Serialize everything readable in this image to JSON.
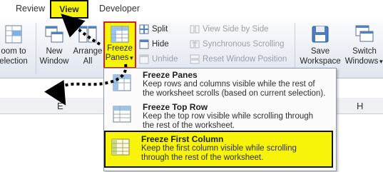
{
  "tabs": {
    "review": "Review",
    "view": "View",
    "developer": "Developer"
  },
  "ribbon": {
    "zoom_to_selection": [
      "oom to",
      "election"
    ],
    "new_window": [
      "New",
      "Window"
    ],
    "arrange_all": [
      "Arrange",
      "All"
    ],
    "freeze_panes": [
      "Freeze",
      "Panes"
    ],
    "split": "Split",
    "hide": "Hide",
    "unhide": "Unhide",
    "view_side_by_side": "View Side by Side",
    "synchronous_scrolling": "Synchronous Scrolling",
    "reset_window_position": "Reset Window Position",
    "save_workspace": [
      "Save",
      "Workspace"
    ],
    "switch_windows": [
      "Switch",
      "Windows"
    ]
  },
  "columns": {
    "e": "E",
    "h": "H"
  },
  "menu": {
    "items": [
      {
        "title": "Freeze Panes",
        "desc": [
          "Keep rows and columns visible while the rest of",
          "the worksheet scrolls (based on current selection)."
        ]
      },
      {
        "title": "Freeze Top Row",
        "desc": [
          "Keep the top row visible while scrolling through",
          "the rest of the worksheet."
        ]
      },
      {
        "title": "Freeze First Column",
        "desc": [
          "Keep the first column visible while scrolling",
          "through the rest of the worksheet."
        ]
      }
    ]
  },
  "colors": {
    "highlight": "#f7f40a",
    "freeze_border": "#d61d1d",
    "arrow": "#000000"
  }
}
